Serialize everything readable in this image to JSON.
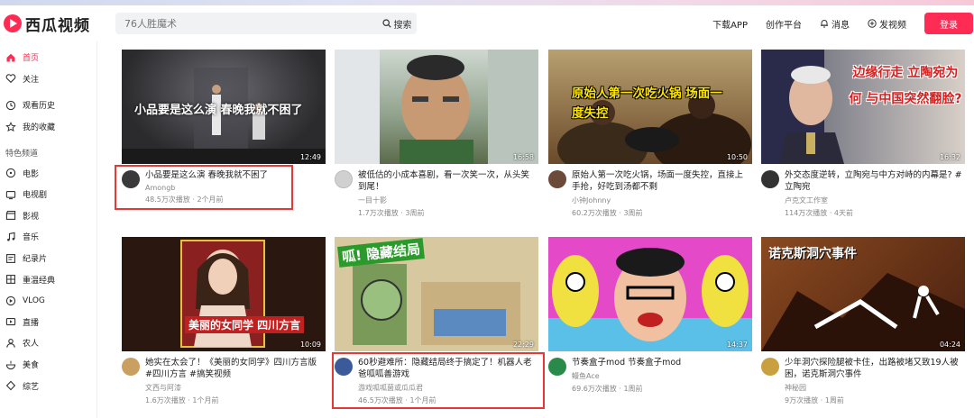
{
  "app": {
    "logo_text": "西瓜视频"
  },
  "search": {
    "placeholder": "76人胜魔术",
    "button_label": "搜索"
  },
  "header_nav": {
    "download": "下载APP",
    "creator": "创作平台",
    "messages": "消息",
    "publish": "发视频",
    "login": "登录"
  },
  "sidebar": {
    "items_top": [
      {
        "label": "首页",
        "icon": "home-icon",
        "active": true
      },
      {
        "label": "关注",
        "icon": "heart-icon"
      }
    ],
    "items_history": [
      {
        "label": "观看历史",
        "icon": "clock-icon"
      },
      {
        "label": "我的收藏",
        "icon": "star-icon"
      }
    ],
    "section_title": "特色频道",
    "channels": [
      {
        "label": "电影",
        "icon": "film-icon"
      },
      {
        "label": "电视剧",
        "icon": "tv-icon"
      },
      {
        "label": "影视",
        "icon": "clapper-icon"
      },
      {
        "label": "音乐",
        "icon": "music-icon"
      },
      {
        "label": "纪录片",
        "icon": "document-icon"
      },
      {
        "label": "重温经典",
        "icon": "grid-icon"
      },
      {
        "label": "VLOG",
        "icon": "camera-icon"
      },
      {
        "label": "直播",
        "icon": "live-icon"
      },
      {
        "label": "农人",
        "icon": "person-icon"
      },
      {
        "label": "美食",
        "icon": "food-icon"
      },
      {
        "label": "综艺",
        "icon": "variety-icon"
      }
    ]
  },
  "videos": [
    {
      "title": "小品要是这么演 春晚我就不困了",
      "overlay": "小品要是这么演 春晚我就不困了",
      "author": "Amongb",
      "views": "48.5万次播放",
      "date": "2个月前",
      "duration": "12:49",
      "avatar_color": "#3a3a3a",
      "thumb_color": "#2b2b2e"
    },
    {
      "title": "被低估的小成本喜剧，看一次笑一次，从头笑到尾！",
      "overlay": "",
      "author": "一目十影",
      "views": "1.7万次播放",
      "date": "3周前",
      "duration": "16:58",
      "avatar_color": "#bbb",
      "thumb_color": "#7a8a6a"
    },
    {
      "title": "原始人第一次吃火锅，场面一度失控，直接上手抢，好吃到汤都不剩",
      "overlay": "原始人第一次吃火锅 场面一度失控",
      "author": "小钟Johnny",
      "views": "60.2万次播放",
      "date": "3周前",
      "duration": "10:50",
      "avatar_color": "#6b4a3a",
      "thumb_color": "#7a5a3a"
    },
    {
      "title": "外交态度逆转，立陶宛与中方对峙的内幕是? #立陶宛",
      "overlay": "边缘行走 立陶宛为何 与中国突然翻脸?",
      "author": "卢克文工作室",
      "views": "114万次播放",
      "date": "4天前",
      "duration": "16:32",
      "avatar_color": "#333",
      "thumb_color": "#4a4a55"
    },
    {
      "title": "她实在太会了！《美丽的女同学》四川方言版 #四川方言 #搞笑视频",
      "overlay": "美丽的女同学 四川方言",
      "author": "文西与阿漆",
      "views": "1.6万次播放",
      "date": "1个月前",
      "duration": "10:09",
      "avatar_color": "#c9a060",
      "thumb_color": "#3a2020"
    },
    {
      "title": "60秒避难所：隐藏结局终于搞定了！机器人老爸呱呱善游戏",
      "overlay": "呱! 隐藏结局",
      "author": "游戏呱呱菌或瓜瓜君",
      "views": "46.5万次播放",
      "date": "1个月前",
      "duration": "22:29",
      "avatar_color": "#3a5a9a",
      "thumb_color": "#e9dcc0"
    },
    {
      "title": "节奏盒子mod 节奏盒子mod",
      "overlay": "",
      "author": "鳗鱼Ace",
      "views": "69.6万次播放",
      "date": "1周前",
      "duration": "14:37",
      "avatar_color": "#2a8a4a",
      "thumb_color": "#e44ac8"
    },
    {
      "title": "少年洞穴探险腿被卡住，出路被堵又致19人被困，诺克斯洞穴事件",
      "overlay": "诺克斯洞穴事件",
      "author": "神秘园",
      "views": "9万次播放",
      "date": "1周前",
      "duration": "04:24",
      "avatar_color": "#c8a040",
      "thumb_color": "#6a3a20"
    }
  ]
}
